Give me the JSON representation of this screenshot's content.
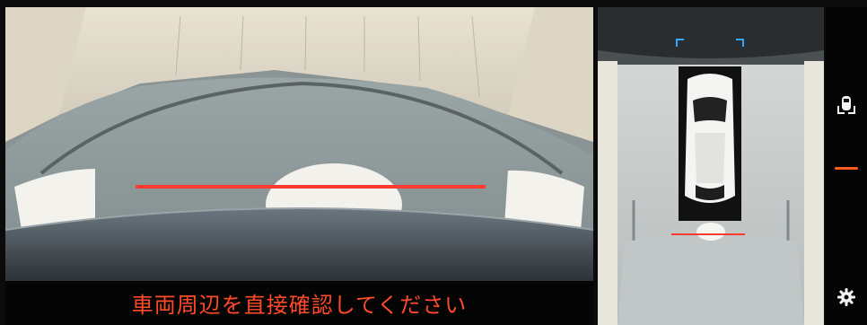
{
  "warning": {
    "message": "車両周辺を直接確認してください"
  },
  "guide_line_color": "#ff3b2f",
  "accent_color": "#ff5a1f",
  "icons": {
    "camera_view": "camera-view-icon",
    "settings": "gear-icon"
  }
}
